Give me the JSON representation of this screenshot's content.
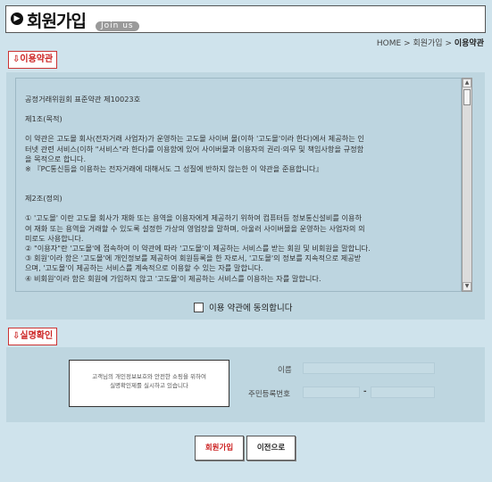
{
  "header": {
    "title": "회원가입",
    "subtitle_pill": "Join us",
    "breadcrumb": [
      "HOME",
      "회원가입",
      "이용약관"
    ]
  },
  "terms": {
    "section_label": "이용약관",
    "lines": [
      "공정거래위원회 표준약관 제10023호",
      "",
      "제1조(목적)",
      "",
      "이 약관은 고도몰 회사(전자거래 사업자)가 운영하는 고도몰 사이버 몰(이하 '고도몰'이라 한다)에서 제공하는 인",
      "터넷 관련 서비스(이하 \"서비스\"라 한다)를 이용함에 있어 사이버몰과 이용자의 권리·의무 및 책임사항을 규정함",
      "을 목적으로 합니다.",
      "※ 『PC통신등을 이용하는 전자거래에 대해서도 그 성질에 반하지 않는한 이 약관을 준용합니다』",
      "",
      "",
      "제2조(정의)",
      "",
      "① '고도몰' 이란 고도몰 회사가 재화 또는 용역을 이용자에게 제공하기 위하여 컴퓨터등 정보통신설비를 이용하",
      "여 재화 또는 용역을 거래할 수 있도록 설정한 가상의 영업장을 말하며, 아울러 사이버몰을 운영하는 사업자의 의",
      "미로도 사용합니다.",
      "② \"이용자\"란 '고도몰'에 접속하여 이 약관에 따라 '고도몰'이 제공하는 서비스를 받는 회원 및 비회원을 말합니다.",
      "③ 회원'이라 함은 '고도몰'에 개인정보를 제공하여 회원등록을 한 자로서, '고도몰'의 정보를 지속적으로 제공받",
      "으며, '고도몰'이 제공하는 서비스를 계속적으로 이용할 수 있는 자를 말합니다.",
      "④ 비회원'이라 함은 회원에 가입하지 않고 '고도몰'이 제공하는 서비스를 이용하는 자를 말합니다."
    ],
    "agree_label": "이용 약관에 동의합니다"
  },
  "verify": {
    "section_label": "실명확인",
    "notice_lines": [
      "고객님의 개인정보보호와 안전한 쇼핑을 위하여",
      "실명확인제를 실시하고 있습니다"
    ],
    "name_label": "이름",
    "name_value": "",
    "rrn_label": "주민등록번호",
    "rrn_sep": "-",
    "rrn_first": "",
    "rrn_second": ""
  },
  "buttons": {
    "join": "회원가입",
    "back": "이전으로"
  },
  "colors": {
    "accent_red": "#cc2222",
    "background": "#cfe3ec"
  }
}
